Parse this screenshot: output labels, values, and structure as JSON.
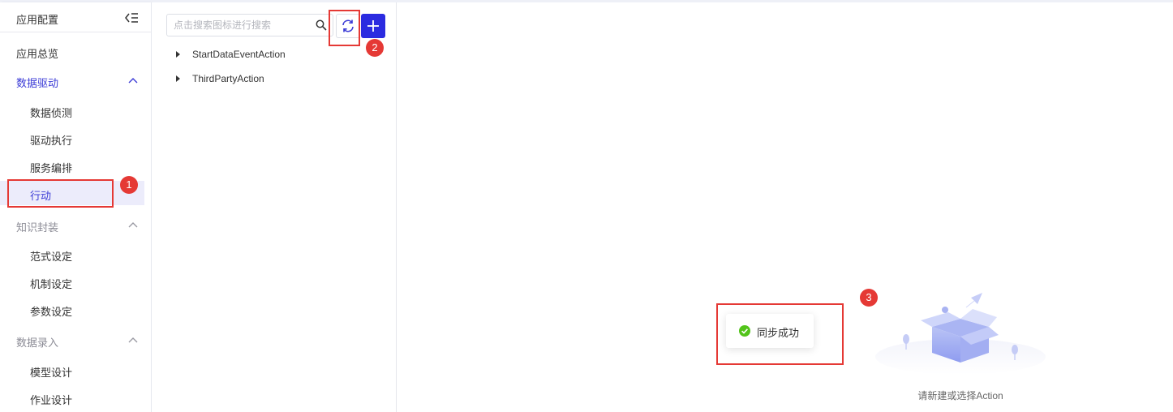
{
  "sidebar": {
    "title": "应用配置",
    "items": [
      {
        "label": "应用总览"
      },
      {
        "label": "数据驱动"
      },
      {
        "label": "数据侦测"
      },
      {
        "label": "驱动执行"
      },
      {
        "label": "服务编排"
      },
      {
        "label": "行动"
      },
      {
        "label": "知识封装"
      },
      {
        "label": "范式设定"
      },
      {
        "label": "机制设定"
      },
      {
        "label": "参数设定"
      },
      {
        "label": "数据录入"
      },
      {
        "label": "模型设计"
      },
      {
        "label": "作业设计"
      }
    ],
    "selected_item": "行动"
  },
  "tree": {
    "search_placeholder": "点击搜索图标进行搜索",
    "search_value": "",
    "nodes": [
      {
        "label": "StartDataEventAction"
      },
      {
        "label": "ThirdPartyAction"
      }
    ]
  },
  "toast": {
    "message": "同步成功"
  },
  "empty_state": {
    "text": "请新建或选择Action"
  },
  "annotations": {
    "badges": [
      "1",
      "2",
      "3"
    ]
  },
  "colors": {
    "accent": "#3b3bd6",
    "primary_button": "#2b2be0",
    "annotation_red": "#e53935",
    "success_green": "#52c41a"
  },
  "icons": [
    "collapse-sidebar-icon",
    "chevron-up-icon",
    "search-icon",
    "refresh-icon",
    "plus-icon",
    "caret-right-icon",
    "check-circle-icon",
    "empty-box-illustration"
  ]
}
